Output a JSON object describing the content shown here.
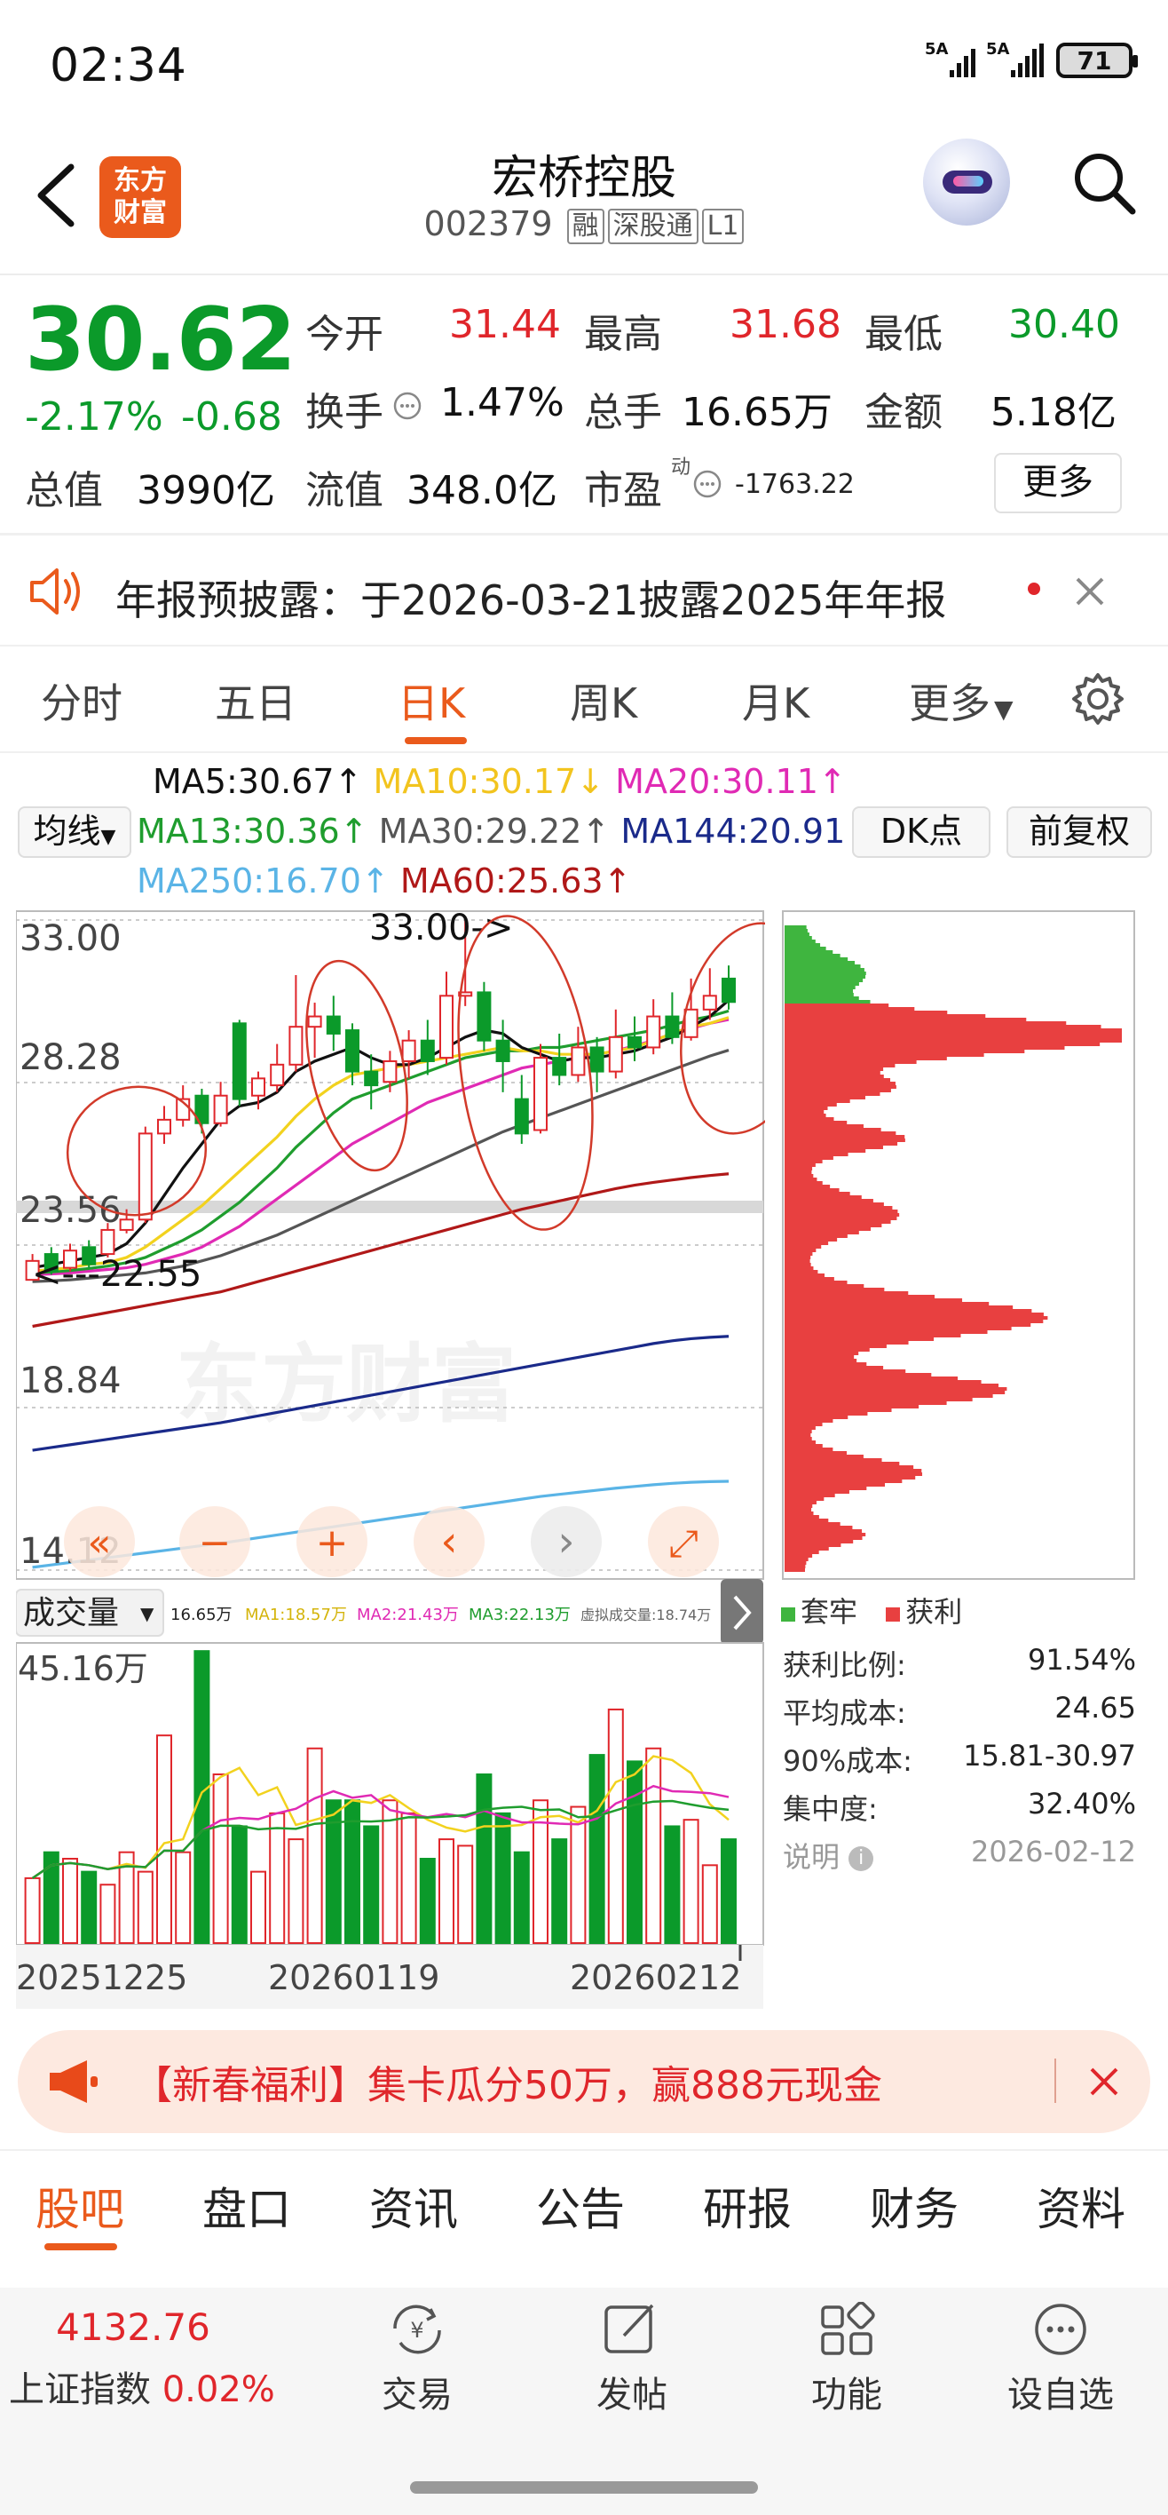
{
  "status": {
    "time": "02:34",
    "net1": "5A",
    "net2": "5A",
    "battery": "71"
  },
  "header": {
    "logo_line1": "东方",
    "logo_line2": "财富",
    "stock_name": "宏桥控股",
    "stock_code": "002379",
    "tags": [
      "融",
      "深股通",
      "L1"
    ]
  },
  "quote": {
    "price": "30.62",
    "change_pct": "-2.17%",
    "change_val": "-0.68",
    "open_label": "今开",
    "open": "31.44",
    "high_label": "最高",
    "high": "31.68",
    "low_label": "最低",
    "low": "30.40",
    "turnover_label": "换手",
    "turnover": "1.47%",
    "volume_label": "总手",
    "volume": "16.65万",
    "amount_label": "金额",
    "amount": "5.18亿",
    "mktcap_label": "总值",
    "mktcap": "3990亿",
    "float_label": "流值",
    "float_cap": "348.0亿",
    "pe_label": "市盈",
    "pe_sup": "动",
    "pe": "-1763.22",
    "more": "更多"
  },
  "notice": {
    "text": "年报预披露：于2026-03-21披露2025年年报"
  },
  "ktabs": [
    "分时",
    "五日",
    "日K",
    "周K",
    "月K",
    "更多"
  ],
  "ma": {
    "ma5": "MA5:30.67",
    "ma10": "MA10:30.17",
    "ma20": "MA20:30.11",
    "ma13": "MA13:30.36",
    "ma30": "MA30:29.22",
    "ma144": "MA144:20.91",
    "ma250": "MA250:16.70",
    "ma60": "MA60:25.63",
    "junxian": "均线",
    "dk": "DK点",
    "fq": "前复权"
  },
  "colors": {
    "up": "#e0262b",
    "down": "#0b9a2a",
    "ma5": "#111111",
    "ma10": "#f2d21e",
    "ma20": "#e02ab4",
    "ma13": "#1f9d2e",
    "ma30": "#555555",
    "ma144": "#1a2a8a",
    "ma250": "#5ab4e6",
    "ma60": "#b01818",
    "accent": "#ea5a1c"
  },
  "chart_data": {
    "type": "candlestick",
    "y_ticks": [
      "33.00",
      "28.28",
      "23.56",
      "18.84",
      "14.12"
    ],
    "ylim": [
      14.12,
      33.0
    ],
    "annotations": [
      "33.00->",
      "<---22.55"
    ],
    "watermark": "东方财富",
    "x_ticks": [
      "20251225",
      "20260119",
      "20260212"
    ],
    "candles": [
      {
        "o": 22.55,
        "c": 23.1,
        "h": 23.3,
        "l": 22.55
      },
      {
        "o": 23.3,
        "c": 22.8,
        "h": 23.5,
        "l": 22.7
      },
      {
        "o": 22.9,
        "c": 23.4,
        "h": 23.6,
        "l": 22.8
      },
      {
        "o": 23.5,
        "c": 23.0,
        "h": 23.7,
        "l": 22.9
      },
      {
        "o": 23.3,
        "c": 24.0,
        "h": 24.2,
        "l": 23.2
      },
      {
        "o": 24.0,
        "c": 24.3,
        "h": 24.6,
        "l": 23.9
      },
      {
        "o": 24.3,
        "c": 26.8,
        "h": 27.0,
        "l": 24.2
      },
      {
        "o": 26.8,
        "c": 27.2,
        "h": 27.6,
        "l": 26.5
      },
      {
        "o": 27.2,
        "c": 27.8,
        "h": 28.2,
        "l": 27.0
      },
      {
        "o": 27.9,
        "c": 27.1,
        "h": 28.1,
        "l": 26.8
      },
      {
        "o": 27.1,
        "c": 27.9,
        "h": 28.3,
        "l": 27.0
      },
      {
        "o": 30.0,
        "c": 27.8,
        "h": 30.1,
        "l": 27.6
      },
      {
        "o": 27.9,
        "c": 28.4,
        "h": 28.6,
        "l": 27.5
      },
      {
        "o": 28.2,
        "c": 28.8,
        "h": 29.4,
        "l": 28.0
      },
      {
        "o": 28.8,
        "c": 29.9,
        "h": 31.4,
        "l": 28.6
      },
      {
        "o": 29.9,
        "c": 30.2,
        "h": 30.6,
        "l": 29.0
      },
      {
        "o": 30.2,
        "c": 29.7,
        "h": 30.8,
        "l": 29.2
      },
      {
        "o": 29.8,
        "c": 28.6,
        "h": 30.0,
        "l": 28.2
      },
      {
        "o": 28.6,
        "c": 28.2,
        "h": 29.1,
        "l": 27.5
      },
      {
        "o": 28.3,
        "c": 28.9,
        "h": 29.2,
        "l": 28.0
      },
      {
        "o": 28.9,
        "c": 29.5,
        "h": 29.8,
        "l": 28.4
      },
      {
        "o": 29.5,
        "c": 28.9,
        "h": 30.1,
        "l": 28.5
      },
      {
        "o": 29.0,
        "c": 30.8,
        "h": 31.5,
        "l": 28.8
      },
      {
        "o": 30.8,
        "c": 30.9,
        "h": 33.0,
        "l": 30.5
      },
      {
        "o": 30.9,
        "c": 29.5,
        "h": 31.2,
        "l": 29.2
      },
      {
        "o": 29.5,
        "c": 28.9,
        "h": 30.1,
        "l": 28.0
      },
      {
        "o": 27.8,
        "c": 26.8,
        "h": 28.5,
        "l": 26.5
      },
      {
        "o": 26.9,
        "c": 29.0,
        "h": 29.4,
        "l": 26.8
      },
      {
        "o": 29.0,
        "c": 28.5,
        "h": 29.7,
        "l": 28.2
      },
      {
        "o": 28.5,
        "c": 29.3,
        "h": 29.9,
        "l": 28.3
      },
      {
        "o": 29.3,
        "c": 28.6,
        "h": 29.6,
        "l": 28.0
      },
      {
        "o": 28.6,
        "c": 29.6,
        "h": 30.4,
        "l": 28.4
      },
      {
        "o": 29.6,
        "c": 29.3,
        "h": 30.2,
        "l": 28.9
      },
      {
        "o": 29.3,
        "c": 30.2,
        "h": 30.7,
        "l": 29.1
      },
      {
        "o": 30.2,
        "c": 29.6,
        "h": 30.9,
        "l": 29.4
      },
      {
        "o": 29.6,
        "c": 30.4,
        "h": 31.3,
        "l": 29.5
      },
      {
        "o": 30.4,
        "c": 30.8,
        "h": 31.6,
        "l": 30.1
      },
      {
        "o": 31.3,
        "c": 30.62,
        "h": 31.68,
        "l": 30.4
      }
    ],
    "ma_lines": {
      "ma5": [
        22.9,
        23.0,
        23.1,
        23.2,
        23.3,
        23.6,
        24.2,
        25.0,
        25.8,
        26.5,
        27.2,
        27.6,
        27.7,
        28.0,
        28.6,
        28.9,
        29.1,
        29.3,
        29.0,
        28.8,
        28.8,
        29.0,
        29.3,
        29.6,
        29.8,
        29.7,
        29.3,
        29.1,
        28.9,
        29.0,
        29.0,
        29.1,
        29.2,
        29.4,
        29.6,
        29.9,
        30.2,
        30.67
      ],
      "ma10": [
        22.8,
        22.85,
        22.9,
        23.0,
        23.05,
        23.2,
        23.5,
        23.9,
        24.3,
        24.7,
        25.2,
        25.7,
        26.2,
        26.7,
        27.3,
        27.8,
        28.2,
        28.5,
        28.6,
        28.7,
        28.8,
        28.9,
        29.0,
        29.1,
        29.2,
        29.3,
        29.2,
        29.2,
        29.1,
        29.1,
        29.1,
        29.2,
        29.3,
        29.5,
        29.7,
        29.9,
        30.0,
        30.17
      ],
      "ma20": [
        22.7,
        22.72,
        22.75,
        22.8,
        22.85,
        22.9,
        23.0,
        23.15,
        23.3,
        23.5,
        23.8,
        24.1,
        24.5,
        24.9,
        25.3,
        25.7,
        26.1,
        26.5,
        26.8,
        27.1,
        27.4,
        27.7,
        27.9,
        28.1,
        28.3,
        28.5,
        28.7,
        28.8,
        28.9,
        29.0,
        29.1,
        29.2,
        29.35,
        29.5,
        29.7,
        29.85,
        30.0,
        30.11
      ],
      "ma13": [
        22.75,
        22.78,
        22.82,
        22.88,
        22.95,
        23.05,
        23.2,
        23.45,
        23.7,
        24.0,
        24.4,
        24.8,
        25.3,
        25.8,
        26.4,
        26.9,
        27.4,
        27.8,
        28.0,
        28.2,
        28.4,
        28.6,
        28.8,
        29.0,
        29.1,
        29.2,
        29.2,
        29.3,
        29.3,
        29.4,
        29.5,
        29.6,
        29.7,
        29.8,
        29.95,
        30.1,
        30.2,
        30.36
      ],
      "ma30": [
        22.5,
        22.52,
        22.55,
        22.6,
        22.65,
        22.7,
        22.75,
        22.85,
        22.95,
        23.1,
        23.25,
        23.45,
        23.65,
        23.85,
        24.1,
        24.35,
        24.6,
        24.85,
        25.1,
        25.35,
        25.6,
        25.85,
        26.1,
        26.35,
        26.6,
        26.85,
        27.05,
        27.25,
        27.45,
        27.65,
        27.85,
        28.05,
        28.25,
        28.45,
        28.65,
        28.85,
        29.05,
        29.22
      ],
      "ma60": [
        21.2,
        21.3,
        21.4,
        21.5,
        21.6,
        21.7,
        21.8,
        21.9,
        22.0,
        22.1,
        22.2,
        22.35,
        22.5,
        22.65,
        22.8,
        22.95,
        23.1,
        23.25,
        23.4,
        23.55,
        23.7,
        23.85,
        24.0,
        24.15,
        24.3,
        24.45,
        24.6,
        24.72,
        24.84,
        24.96,
        25.08,
        25.2,
        25.3,
        25.38,
        25.45,
        25.52,
        25.58,
        25.63
      ],
      "ma144": [
        17.6,
        17.68,
        17.76,
        17.84,
        17.92,
        18.0,
        18.08,
        18.16,
        18.24,
        18.32,
        18.4,
        18.5,
        18.6,
        18.7,
        18.8,
        18.9,
        19.0,
        19.1,
        19.2,
        19.3,
        19.4,
        19.5,
        19.6,
        19.7,
        19.8,
        19.9,
        20.0,
        20.1,
        20.2,
        20.3,
        20.4,
        20.5,
        20.6,
        20.7,
        20.78,
        20.84,
        20.88,
        20.91
      ],
      "ma250": [
        14.2,
        14.27,
        14.34,
        14.41,
        14.48,
        14.55,
        14.62,
        14.69,
        14.76,
        14.83,
        14.9,
        14.98,
        15.06,
        15.14,
        15.22,
        15.3,
        15.38,
        15.46,
        15.54,
        15.62,
        15.7,
        15.78,
        15.86,
        15.94,
        16.02,
        16.1,
        16.18,
        16.26,
        16.32,
        16.38,
        16.44,
        16.5,
        16.55,
        16.6,
        16.64,
        16.67,
        16.69,
        16.7
      ]
    },
    "volume": {
      "label": "成交量",
      "vol": "16.65万",
      "ma1": "MA1:18.57万",
      "ma2": "MA2:21.43万",
      "ma3": "MA3:22.13万",
      "virtual": "虚拟成交量:18.74万",
      "max_label": "45.16万",
      "values": [
        10,
        14,
        13,
        11,
        9,
        14,
        11,
        32,
        14,
        45,
        26,
        18,
        11,
        20,
        16,
        30,
        22,
        22,
        18,
        22,
        20,
        13,
        16,
        15,
        26,
        20,
        14,
        22,
        16,
        21,
        29,
        36,
        28,
        30,
        18,
        19,
        12,
        16
      ]
    }
  },
  "chip_profile": {
    "legend_trap": "套牢",
    "legend_profit": "获利",
    "profit_ratio_label": "获利比例:",
    "profit_ratio": "91.54%",
    "avg_cost_label": "平均成本:",
    "avg_cost": "24.65",
    "cost90_label": "90%成本:",
    "cost90": "15.81-30.97",
    "concentration_label": "集中度:",
    "concentration": "32.40%",
    "note_label": "说明",
    "date": "2026-02-12"
  },
  "chart_buttons": [
    "«",
    "−",
    "+",
    "‹",
    "›",
    "⤢"
  ],
  "banner": {
    "text": "【新春福利】集卡瓜分50万，赢888元现金"
  },
  "bottom_tabs": [
    "股吧",
    "盘口",
    "资讯",
    "公告",
    "研报",
    "财务",
    "资料"
  ],
  "footer": {
    "index_value": "4132.76",
    "index_name": "上证指数",
    "index_change": "0.02%",
    "trade": "交易",
    "post": "发帖",
    "func": "功能",
    "watch": "设自选"
  }
}
